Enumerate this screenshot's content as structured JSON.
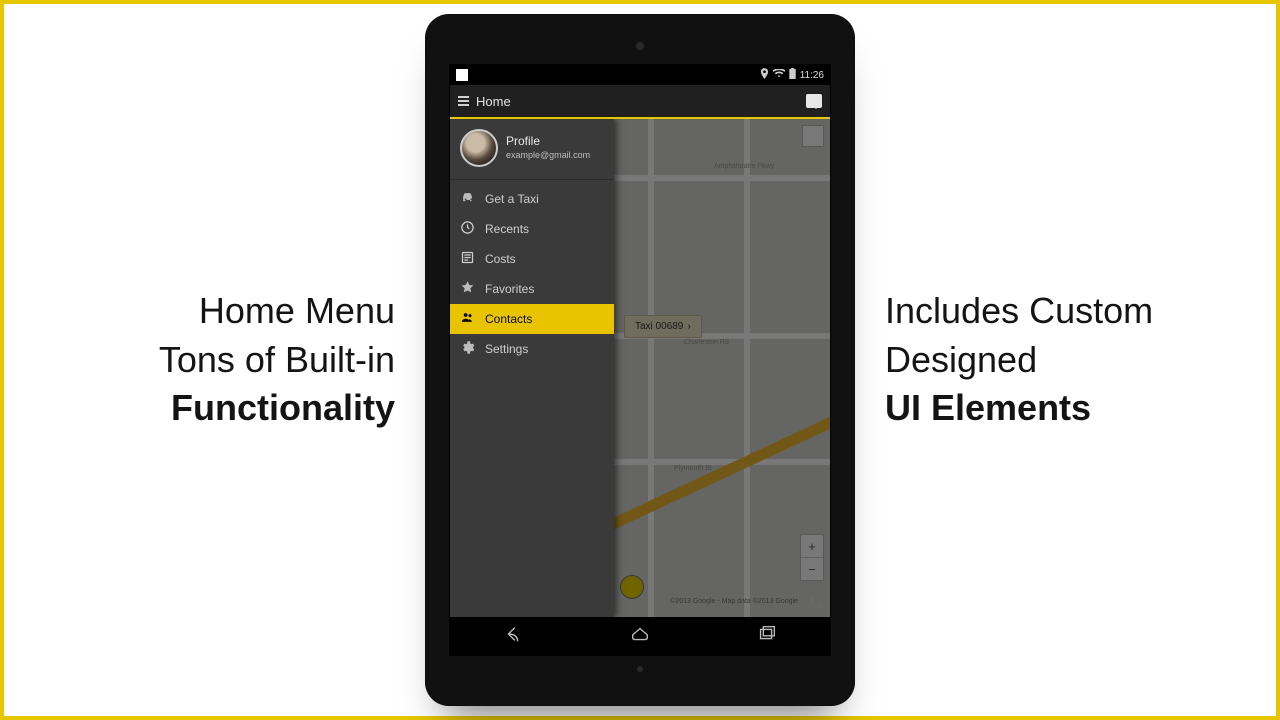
{
  "promo_left": {
    "l1": "Home Menu",
    "l2": "Tons of Built-in",
    "l3": "Functionality"
  },
  "promo_right": {
    "l1": "Includes Custom",
    "l2": "Designed",
    "l3": "UI Elements"
  },
  "statusbar": {
    "time": "11:26"
  },
  "actionbar": {
    "title": "Home"
  },
  "profile": {
    "title": "Profile",
    "email": "example@gmail.com"
  },
  "menu": [
    {
      "label": "Get a Taxi",
      "icon": "taxi",
      "selected": false
    },
    {
      "label": "Recents",
      "icon": "clock",
      "selected": false
    },
    {
      "label": "Costs",
      "icon": "costs",
      "selected": false
    },
    {
      "label": "Favorites",
      "icon": "star",
      "selected": false
    },
    {
      "label": "Contacts",
      "icon": "contacts",
      "selected": true
    },
    {
      "label": "Settings",
      "icon": "gear",
      "selected": false
    }
  ],
  "map": {
    "callout_label": "Taxi 00689",
    "attribution": "©2013 Google - Map data ©2013 Google",
    "streets": [
      "Amphitheatre Pkwy",
      "Charleston Rd",
      "Plymouth St"
    ]
  },
  "colors": {
    "accent": "#e5c600"
  }
}
